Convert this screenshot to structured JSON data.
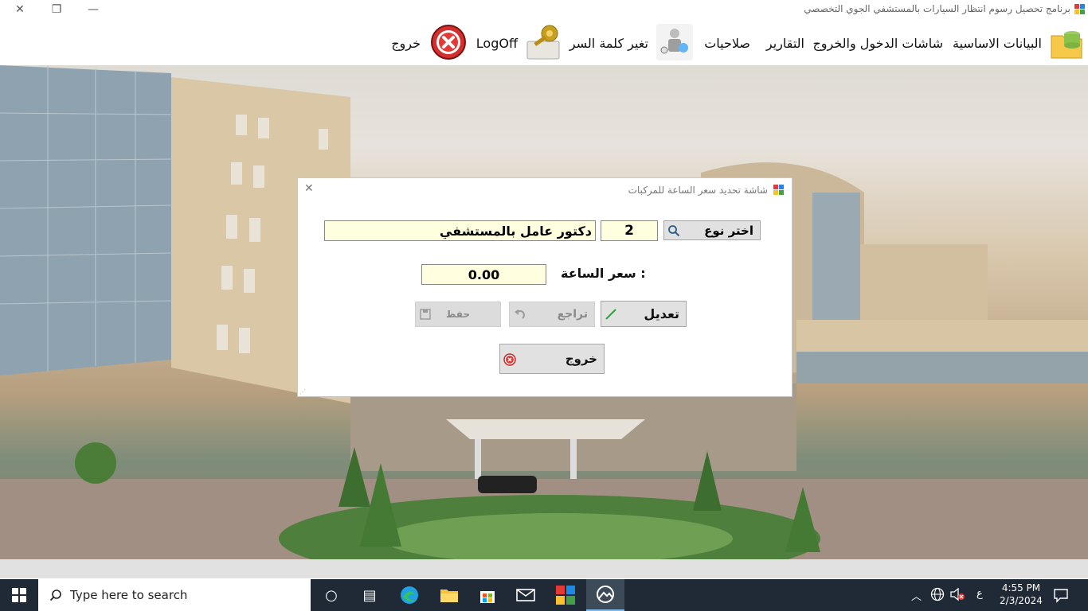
{
  "window": {
    "title": "برنامج تحصيل رسوم انتظار السيارات بالمستشفي الجوي التخصصي",
    "controls": {
      "close": "✕",
      "restore": "❐",
      "minimize": "—"
    }
  },
  "menu": {
    "basic_data": "البيانات الاساسية",
    "entry_exit_screens": "شاشات الدخول والخروج",
    "reports": "التقارير",
    "permissions": "صلاحيات",
    "change_password": "تغير كلمة السر",
    "logoff": "LogOff",
    "exit": "خروج"
  },
  "dialog": {
    "title": "شاشة تحديد سعر الساعة للمركبات",
    "choose_type_button": "اختر نوع",
    "type_code": "2",
    "type_name": "دكتور عامل بالمستشفي",
    "hour_price_label": "سعر الساعة :",
    "hour_price_value": "0.00",
    "edit_button": "تعديل",
    "undo_button": "تراجع",
    "save_button": "حفظ",
    "exit_button": "خروج"
  },
  "taskbar": {
    "search_placeholder": "Type here to search",
    "time": "4:55 PM",
    "date": "2/3/2024",
    "input_language": "ع"
  },
  "colors": {
    "field_background": "#ffffe0",
    "taskbar": "#1f2a36",
    "exit_icon_red": "#d32f2f"
  }
}
